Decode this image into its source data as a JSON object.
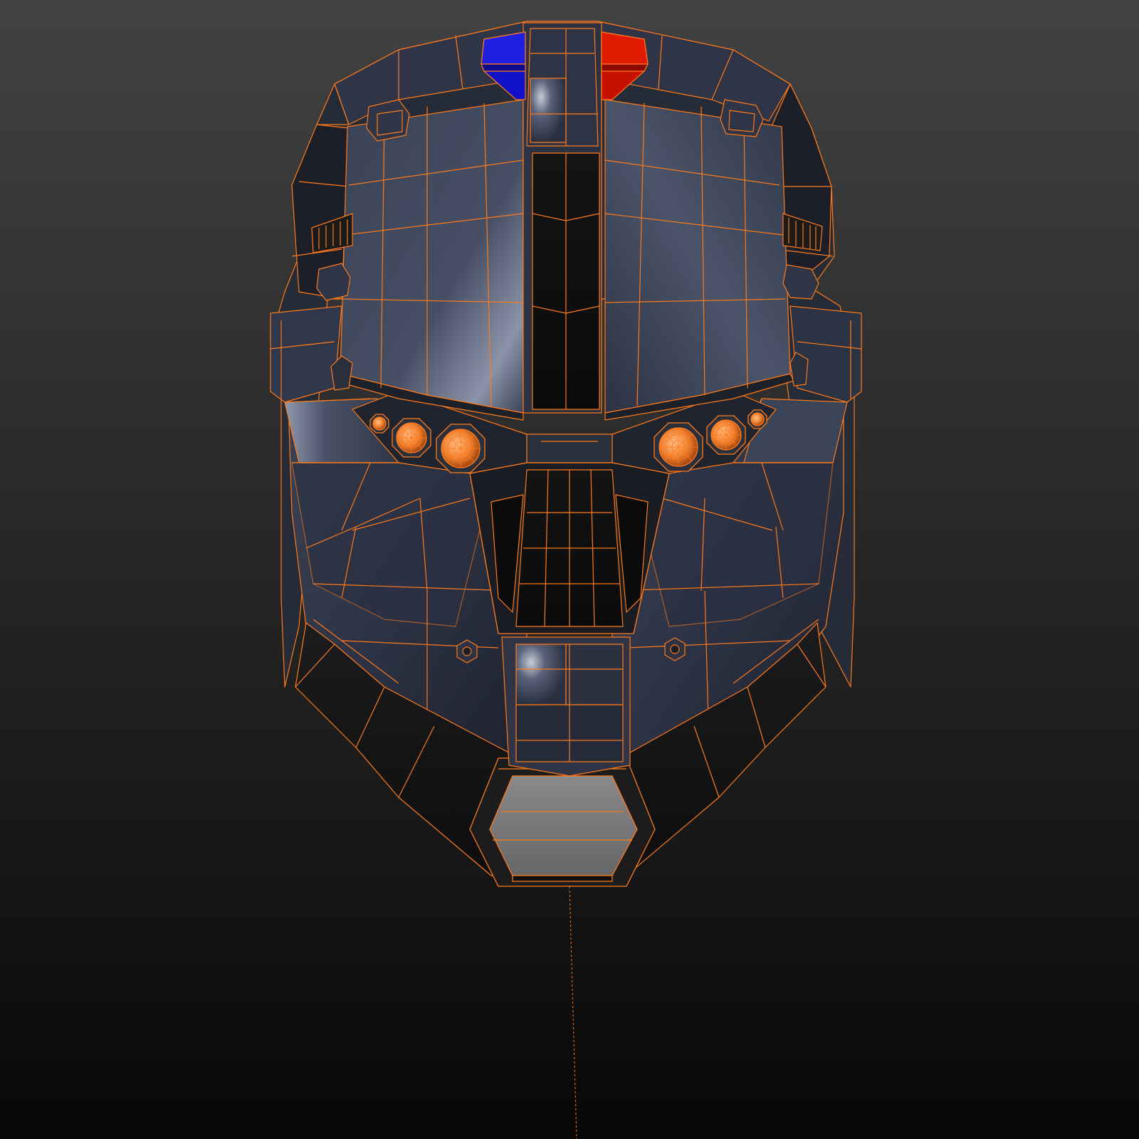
{
  "viewport": {
    "object": "helmet-mesh",
    "shading": "solid-with-wireframe-overlay"
  },
  "colors": {
    "background_top": "#424242",
    "background_bottom": "#070707",
    "wire": "#ff7a1a",
    "panel": "#323849",
    "panel_light": "#59627a",
    "panel_dark": "#1f2330",
    "void": "#0f0f0f",
    "light_blue": "#1010c8",
    "light_red": "#d01000",
    "lens": "#e8732a",
    "lens_highlight": "#ffb27a",
    "mouth_plate": "#7a7a7a"
  }
}
